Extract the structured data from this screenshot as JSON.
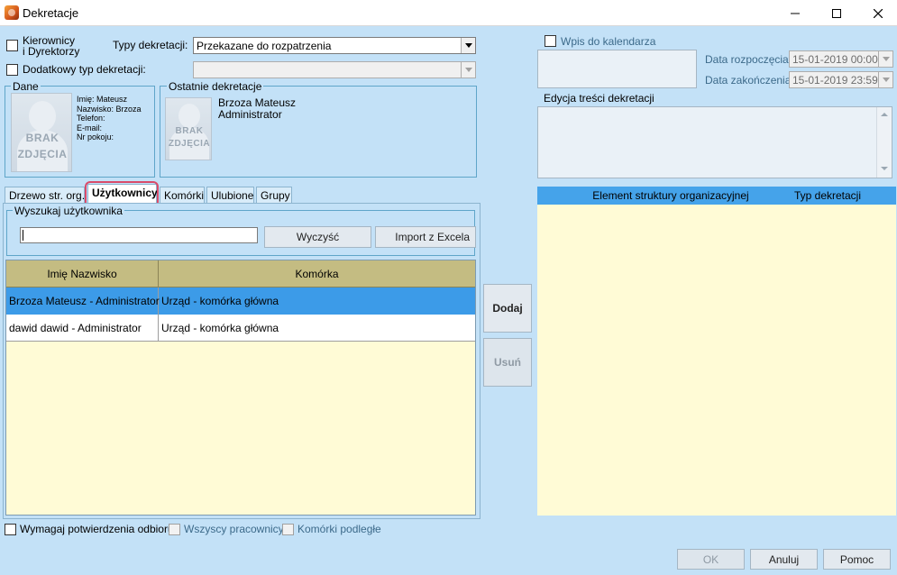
{
  "window": {
    "title": "Dekretacje"
  },
  "top": {
    "kierownicy_line1": "Kierownicy",
    "kierownicy_line2": "i Dyrektorzy",
    "typy_label": "Typy dekretacji:",
    "typy_value": "Przekazane do rozpatrzenia",
    "dodatkowy_label": "Dodatkowy typ dekretacji:",
    "dodatkowy_value": ""
  },
  "dane": {
    "title": "Dane",
    "photo_line1": "BRAK",
    "photo_line2": "ZDJĘCIA",
    "imie": "Imię: Mateusz",
    "nazwisko": "Nazwisko: Brzoza",
    "telefon": "Telefon:",
    "email": "E-mail:",
    "pokoj": "Nr pokoju:"
  },
  "ostatnie": {
    "title": "Ostatnie dekretacje",
    "photo_line1": "BRAK",
    "photo_line2": "ZDJĘCIA",
    "name": "Brzoza Mateusz",
    "role": "Administrator"
  },
  "tabs": [
    {
      "label": "Drzewo str. org."
    },
    {
      "label": "Użytkownicy"
    },
    {
      "label": "Komórki"
    },
    {
      "label": "Ulubione"
    },
    {
      "label": "Grupy"
    }
  ],
  "search": {
    "group_title": "Wyszukaj użytkownika",
    "value": "",
    "clear_label": "Wyczyść",
    "import_label": "Import z Excela"
  },
  "users_table": {
    "columns": [
      "Imię Nazwisko",
      "Komórka"
    ],
    "rows": [
      {
        "name": "Brzoza Mateusz - Administrator",
        "cell": "Urząd - komórka główna",
        "selected": true
      },
      {
        "name": "dawid dawid - Administrator",
        "cell": "Urząd - komórka główna",
        "selected": false
      }
    ]
  },
  "actions": {
    "add_label": "Dodaj",
    "remove_label": "Usuń"
  },
  "calendar": {
    "wpis_label": "Wpis do kalendarza",
    "start_label": "Data rozpoczęcia:",
    "start_value": "15-01-2019  00:00",
    "end_label": "Data zakończenia:",
    "end_value": "15-01-2019  23:59"
  },
  "edit": {
    "label": "Edycja treści dekretacji",
    "value": ""
  },
  "right_table": {
    "columns": [
      "Element struktury organizacyjnej",
      "Typ dekretacji"
    ]
  },
  "bottom": {
    "wymagaj_label": "Wymagaj potwierdzenia odbioru",
    "wszyscy_label": "Wszyscy pracownicy",
    "komorki_label": "Komórki podległe",
    "ok_label": "OK",
    "anuluj_label": "Anuluj",
    "pomoc_label": "Pomoc"
  },
  "colors": {
    "background": "#c3e1f7",
    "selected_row": "#3c9be8",
    "grid_header": "#c4bc82",
    "grid_body": "#fffbd6",
    "tab_highlight": "#d94b6a"
  }
}
